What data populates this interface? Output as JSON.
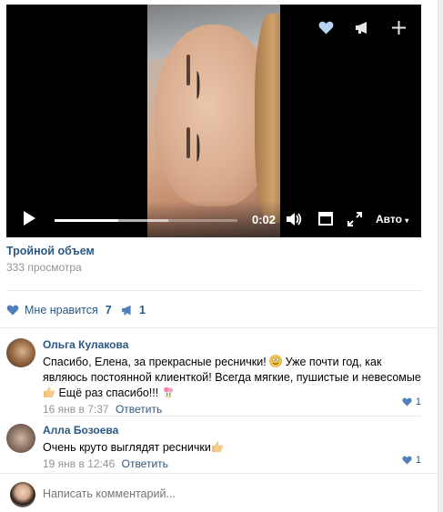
{
  "video": {
    "time": "0:02",
    "quality": "Авто",
    "progress_played": 0.35,
    "progress_loaded": 0.62,
    "title": "Тройной объем",
    "views": "333 просмотра"
  },
  "reactions": {
    "like_label": "Мне нравится",
    "like_count": "7",
    "repost_count": "1"
  },
  "comments": [
    {
      "author": "Ольга Кулакова",
      "text_a": "Спасибо, Елена, за прекрасные реснички! ",
      "text_b": " Уже почти год, как являюсь постоянной клиенткой! Всегда мягкие, пушистые и невесомые",
      "text_c": " Ещё раз спасибо!!! ",
      "date": "16 янв в 7:37",
      "reply": "Ответить",
      "likes": "1"
    },
    {
      "author": "Алла Бозоева",
      "text_a": "Очень круто выглядят реснички",
      "date": "19 янв в 12:46",
      "reply": "Ответить",
      "likes": "1"
    }
  ],
  "composer": {
    "placeholder": "Написать комментарий..."
  },
  "colors": {
    "link": "#2a5885",
    "muted": "#939393",
    "like_icon": "#5181b8"
  },
  "icons": [
    "heart-icon",
    "megaphone-icon",
    "plus-icon",
    "play-icon",
    "volume-icon",
    "miniplayer-icon",
    "fullscreen-icon",
    "smile-emoji-icon",
    "thumbs-up-emoji-icon",
    "flowers-emoji-icon"
  ]
}
